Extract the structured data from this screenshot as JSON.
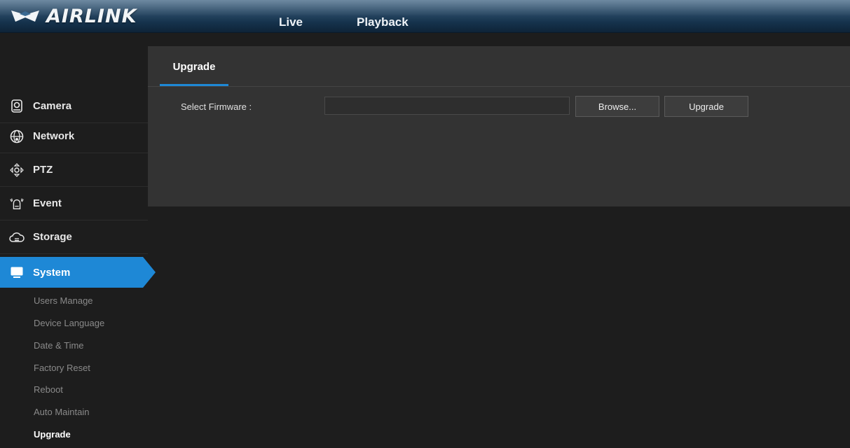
{
  "header": {
    "logo_text": "AIRLINK",
    "nav": [
      {
        "label": "Live"
      },
      {
        "label": "Playback"
      }
    ]
  },
  "sidebar": {
    "items": [
      {
        "label": "Camera",
        "icon": "camera-icon"
      },
      {
        "label": "Network",
        "icon": "globe-icon"
      },
      {
        "label": "PTZ",
        "icon": "ptz-icon"
      },
      {
        "label": "Event",
        "icon": "alarm-icon"
      },
      {
        "label": "Storage",
        "icon": "cloud-icon"
      },
      {
        "label": "System",
        "icon": "monitor-icon",
        "active": true
      }
    ],
    "sub_items": [
      {
        "label": "Users Manage"
      },
      {
        "label": "Device Language"
      },
      {
        "label": "Date & Time"
      },
      {
        "label": "Factory Reset"
      },
      {
        "label": "Reboot"
      },
      {
        "label": "Auto Maintain"
      },
      {
        "label": "Upgrade",
        "current": true
      }
    ]
  },
  "main": {
    "tab_label": "Upgrade",
    "firmware_label": "Select Firmware :",
    "firmware_value": "",
    "browse_label": "Browse...",
    "upgrade_label": "Upgrade"
  },
  "colors": {
    "accent": "#1e88d6",
    "panel": "#333333",
    "background": "#1d1d1d"
  }
}
